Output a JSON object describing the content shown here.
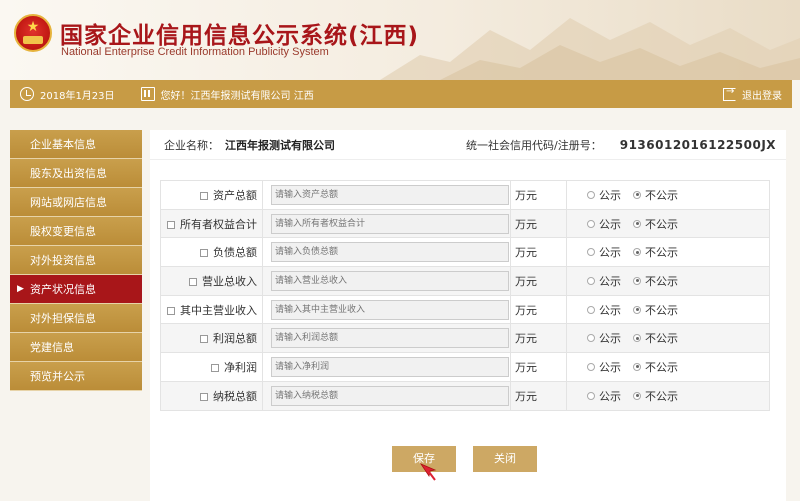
{
  "header": {
    "title": "国家企业信用信息公示系统(江西)",
    "subtitle": "National Enterprise Credit Information Publicity System"
  },
  "infobar": {
    "date": "2018年1月23日",
    "greeting": "您好！江西年报测试有限公司  江西",
    "logout": "退出登录"
  },
  "sidebar": {
    "items": [
      {
        "label": "企业基本信息",
        "active": false
      },
      {
        "label": "股东及出资信息",
        "active": false
      },
      {
        "label": "网站或网店信息",
        "active": false
      },
      {
        "label": "股权变更信息",
        "active": false
      },
      {
        "label": "对外投资信息",
        "active": false
      },
      {
        "label": "资产状况信息",
        "active": true
      },
      {
        "label": "对外担保信息",
        "active": false
      },
      {
        "label": "党建信息",
        "active": false
      },
      {
        "label": "预览并公示",
        "active": false
      }
    ]
  },
  "company": {
    "name_label": "企业名称：",
    "name": "江西年报测试有限公司",
    "code_label": "统一社会信用代码/注册号：",
    "code": "91360120161225​00JX"
  },
  "form": {
    "unit": "万元",
    "public_label": "公示",
    "private_label": "不公示",
    "rows": [
      {
        "label": "资产总额",
        "placeholder": "请输入资产总额"
      },
      {
        "label": "所有者权益合计",
        "placeholder": "请输入所有者权益合计"
      },
      {
        "label": "负债总额",
        "placeholder": "请输入负债总额"
      },
      {
        "label": "营业总收入",
        "placeholder": "请输入营业总收入"
      },
      {
        "label": "其中主营业收入",
        "placeholder": "请输入其中主营业收入"
      },
      {
        "label": "利润总额",
        "placeholder": "请输入利润总额"
      },
      {
        "label": "净利润",
        "placeholder": "请输入净利润"
      },
      {
        "label": "纳税总额",
        "placeholder": "请输入纳税总额"
      }
    ]
  },
  "actions": {
    "save": "保存",
    "close": "关闭"
  },
  "colors": {
    "gold": "#c79b45",
    "active_red": "#a81619",
    "title_red": "#a8161a"
  }
}
